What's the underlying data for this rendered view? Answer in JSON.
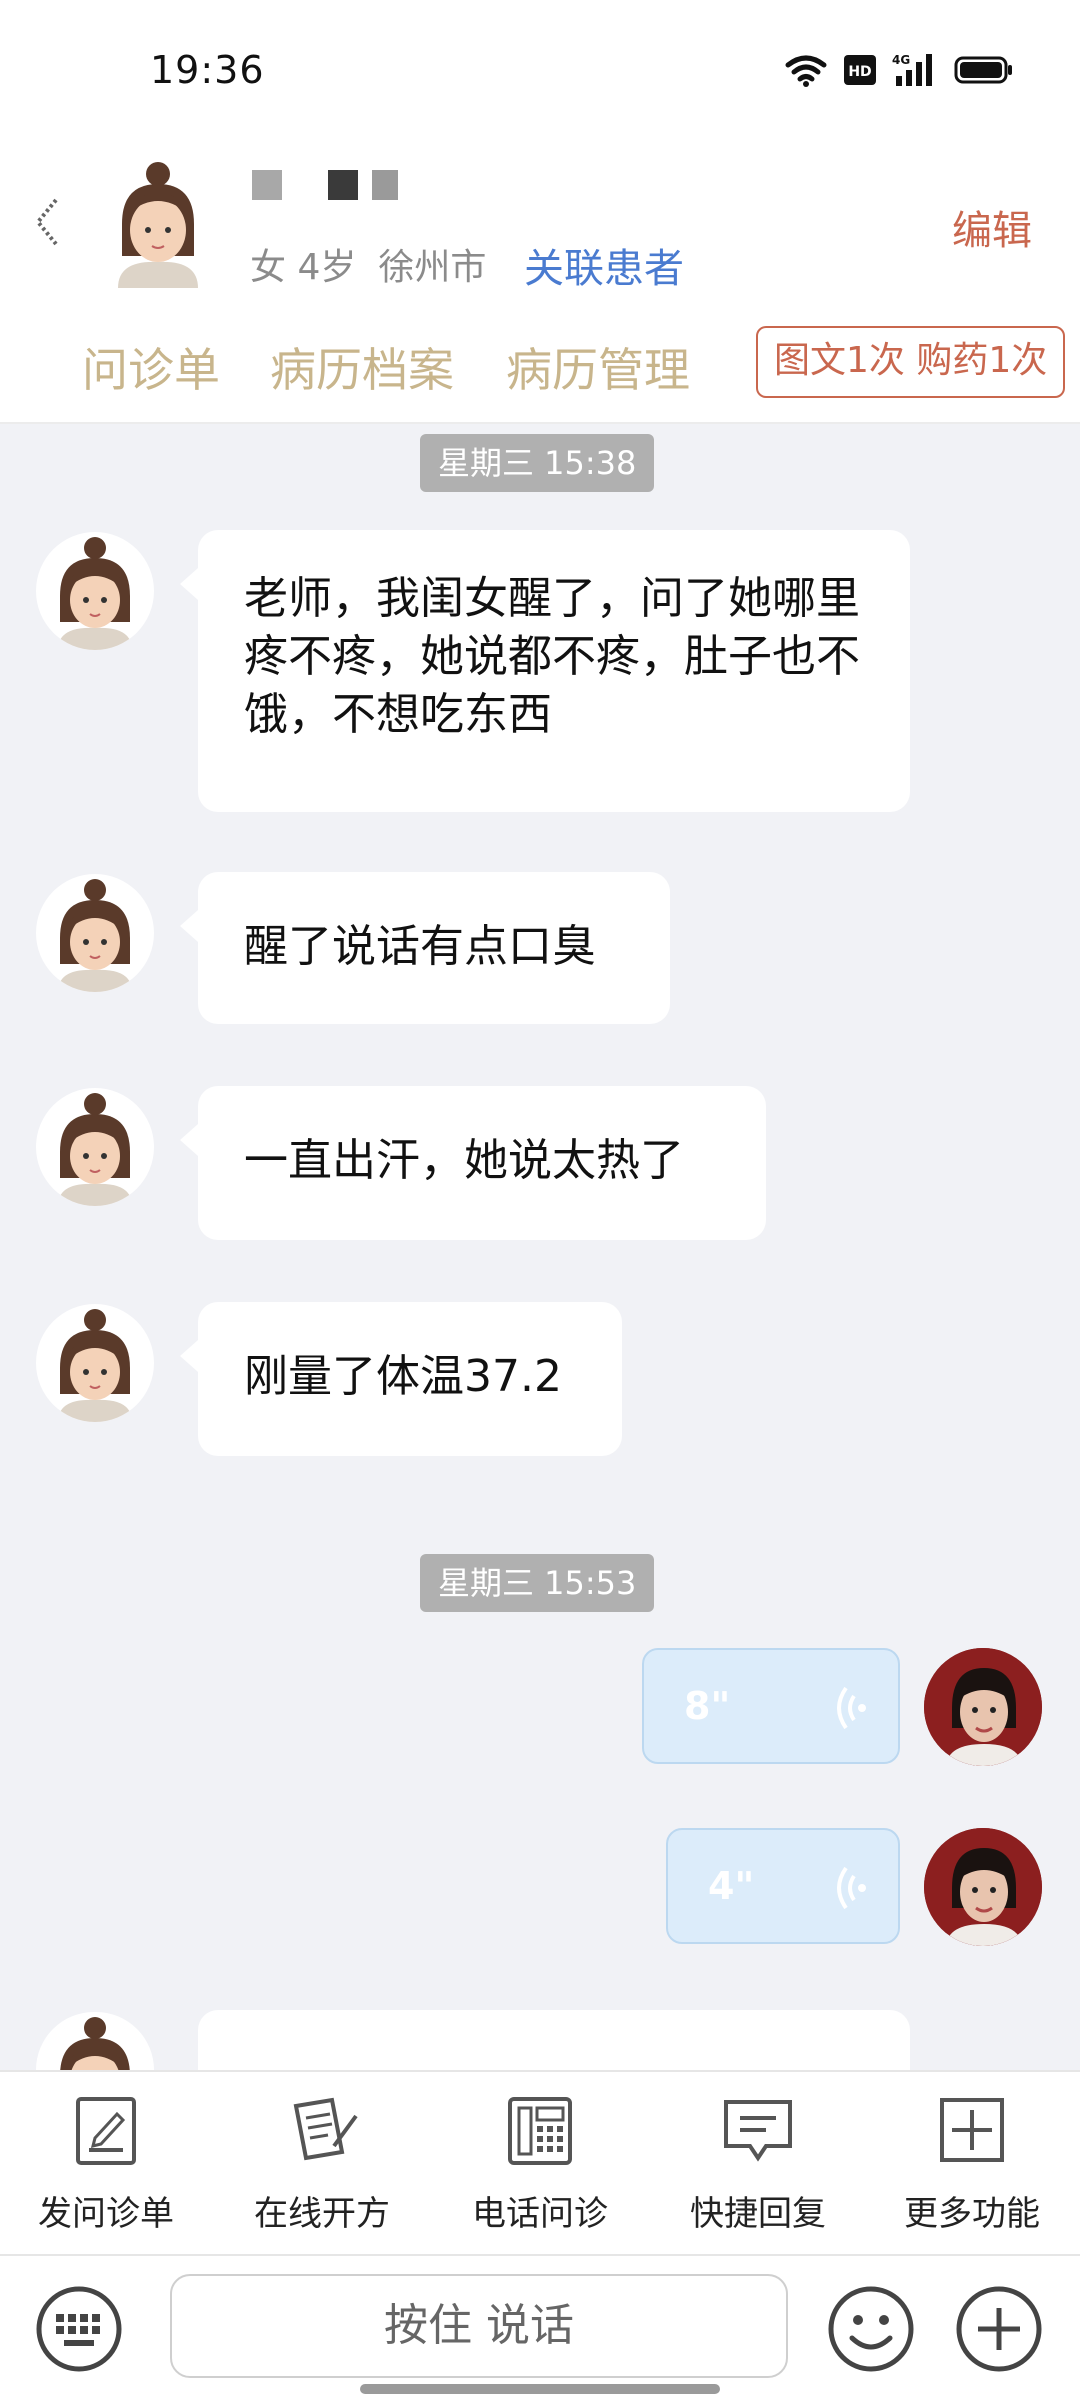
{
  "status": {
    "time": "19:36"
  },
  "header": {
    "gender_age": "女 4岁",
    "city": "徐州市",
    "link_patient": "关联患者",
    "edit": "编辑",
    "tabs": [
      "问诊单",
      "病历档案",
      "病历管理"
    ],
    "quota": "图文1次 购药1次"
  },
  "chat": {
    "time_1": "星期三 15:38",
    "time_2": "星期三 15:53",
    "msg_1": "老师，我闺女醒了，问了她哪里疼不疼，她说都不疼，肚子也不饿，不想吃东西",
    "msg_2": "醒了说话有点口臭",
    "msg_3": "一直出汗，她说太热了",
    "msg_4": "刚量了体温37.2",
    "voice_1": "8\"",
    "voice_2": "4\""
  },
  "functions": [
    "发问诊单",
    "在线开方",
    "电话问诊",
    "快捷回复",
    "更多功能"
  ],
  "input": {
    "press_to_talk": "按住 说话"
  },
  "colors": {
    "accent_red": "#c9674e",
    "link_blue": "#4a7bd0",
    "tab_gold": "#c8b58c",
    "voice_bg": "#dcecfa"
  },
  "icons": [
    "wifi-icon",
    "hd-icon",
    "signal-4g-icon",
    "battery-icon",
    "back-icon",
    "keyboard-icon",
    "emoji-icon",
    "plus-icon"
  ]
}
